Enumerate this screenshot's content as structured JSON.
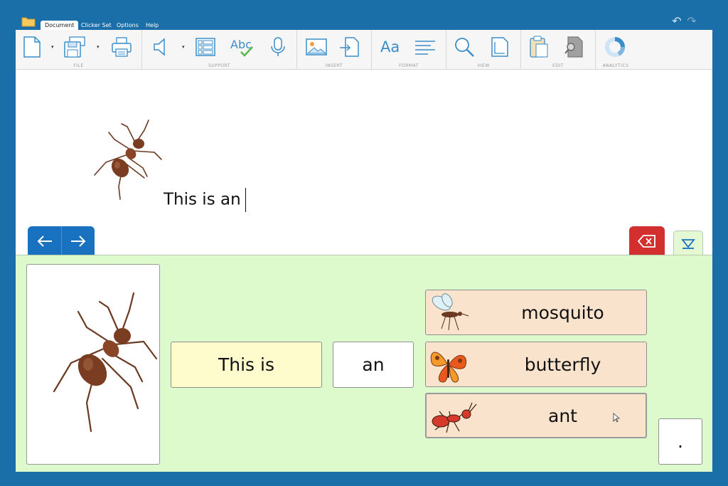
{
  "menu": {
    "tabs": [
      "Document",
      "Clicker Set",
      "Options",
      "Help"
    ],
    "active_tab": "Document"
  },
  "ribbon": {
    "groups": {
      "file": "FILE",
      "support": "SUPPORT",
      "insert": "INSERT",
      "format": "FORMAT",
      "view": "VIEW",
      "edit": "EDIT",
      "analytics": "ANALYTICS"
    },
    "format_font_label": "Aa",
    "support_spell_label": "Abc"
  },
  "document": {
    "text": "This is an"
  },
  "clicker": {
    "cells": {
      "this_is": "This is",
      "an": "an",
      "mosquito": "mosquito",
      "butterfly": "butterfly",
      "ant": "ant",
      "period": "."
    }
  },
  "colors": {
    "frame": "#1a6fa8",
    "nav_blue": "#1872c0",
    "delete_red": "#d42f2f",
    "panel_green": "#dcfacb",
    "cell_yellow": "#fefccc",
    "cell_peach": "#f9e3cc"
  }
}
